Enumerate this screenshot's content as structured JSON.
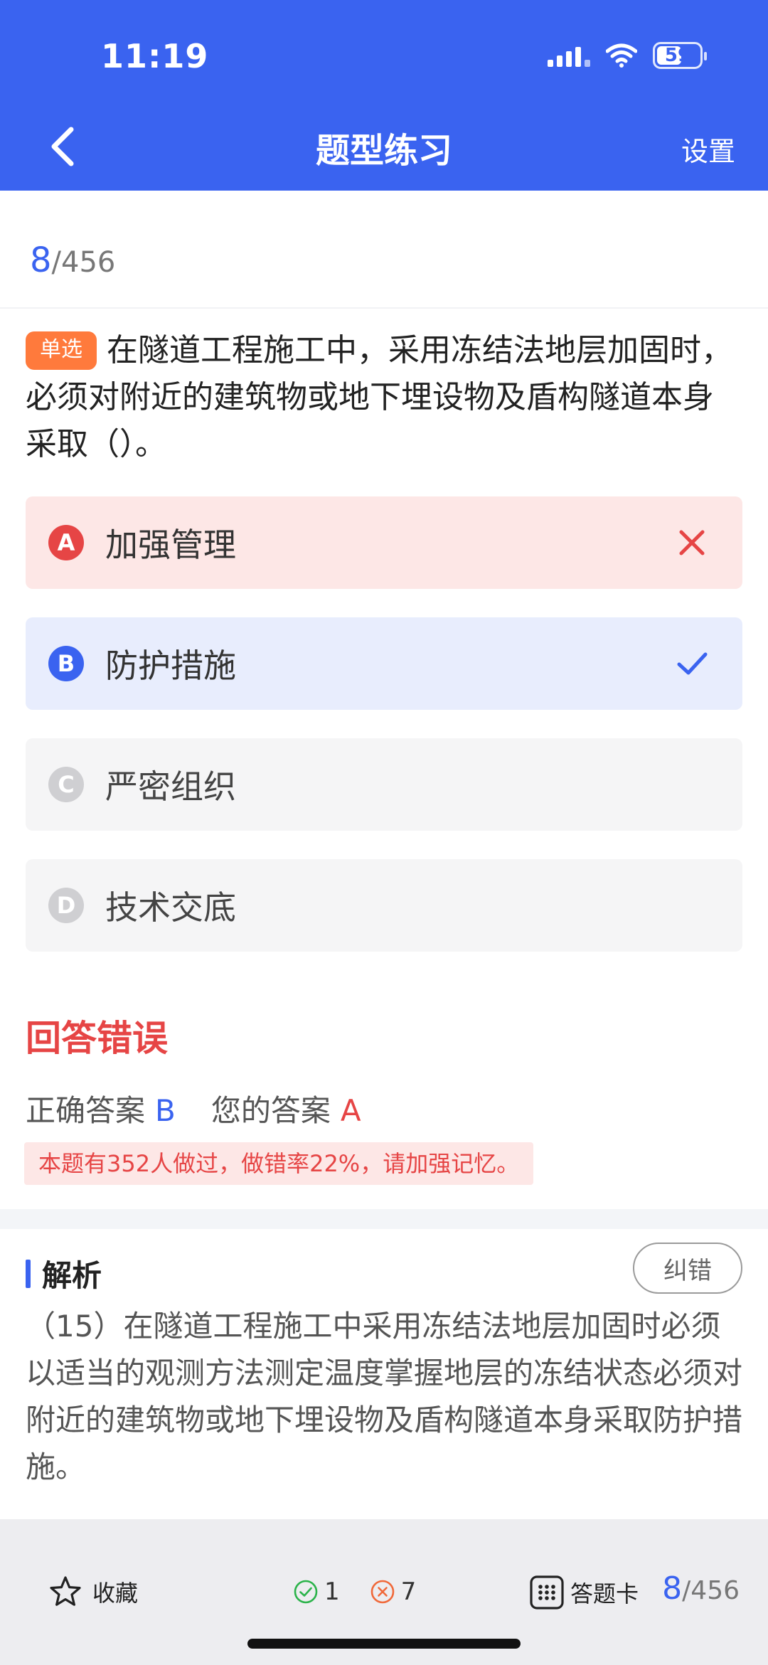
{
  "status_bar": {
    "time": "11:19",
    "battery": "59",
    "battery_level": 0.59
  },
  "nav": {
    "title": "题型练习",
    "settings": "设置"
  },
  "progress": {
    "current": "8",
    "total": "/456"
  },
  "question": {
    "type_tag": "单选",
    "text": "在隧道工程施工中，采用冻结法地层加固时，必须对附近的建筑物或地下埋设物及盾构隧道本身采取（）。"
  },
  "options": [
    {
      "letter": "A",
      "text": "加强管理",
      "state": "wrong"
    },
    {
      "letter": "B",
      "text": "防护措施",
      "state": "correct"
    },
    {
      "letter": "C",
      "text": "严密组织",
      "state": "normal"
    },
    {
      "letter": "D",
      "text": "技术交底",
      "state": "normal"
    }
  ],
  "result": {
    "title": "回答错误",
    "correct_label": "正确答案",
    "correct_value": "B",
    "yours_label": "您的答案",
    "yours_value": "A",
    "stat": "本题有352人做过，做错率22%，请加强记忆。"
  },
  "analysis": {
    "title": "解析",
    "report_button": "纠错",
    "text": "（15）在隧道工程施工中采用冻结法地层加固时必须以适当的观测方法测定温度掌握地层的冻结状态必须对附近的建筑物或地下埋设物及盾构隧道本身采取防护措施。"
  },
  "bottom_bar": {
    "favorite": "收藏",
    "correct_count": "1",
    "wrong_count": "7",
    "answer_card": "答题卡",
    "current": "8",
    "total": "/456"
  },
  "colors": {
    "primary": "#3a63f0",
    "error": "#e64545",
    "tag": "#ff7a3c",
    "success": "#2bb34a"
  }
}
